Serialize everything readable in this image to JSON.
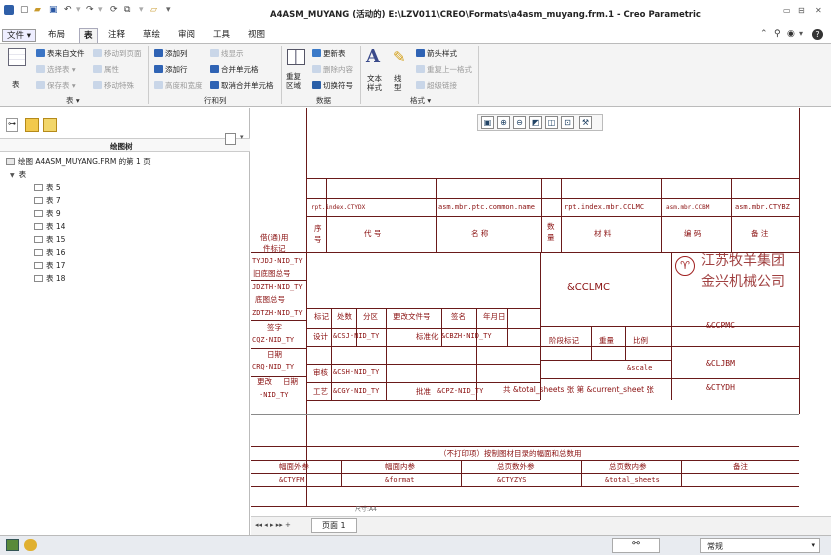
{
  "window": {
    "title": "A4ASM_MUYANG (活动的) E:\\LZV011\\CREO\\Formats\\a4asm_muyang.frm.1 - Creo Parametric",
    "minimize": "▭",
    "restore": "⊟",
    "close": "✕"
  },
  "menu": {
    "file": "文件 ▾",
    "tabs": [
      "布局",
      "表",
      "注释",
      "草绘",
      "审阅",
      "工具",
      "视图"
    ]
  },
  "ribbon": {
    "table_group": {
      "big": "表",
      "items": [
        "表来自文件",
        "移动到页面",
        "选择表 ▾",
        "属性",
        "保存表 ▾",
        "移动特殊"
      ],
      "label": "表 ▾"
    },
    "rowcol_group": {
      "items": [
        "添加列",
        "线显示",
        "添加行",
        "合并单元格",
        "高度和宽度",
        "取消合并单元格"
      ],
      "label": "行和列"
    },
    "data_group": {
      "big": "重复区域",
      "items": [
        "更新表",
        "删除内容",
        "切换符号"
      ],
      "label": "数据"
    },
    "format_group": {
      "text_style": "文本样式",
      "line_style": "线型",
      "items": [
        "箭头样式",
        "重复上一格式",
        "超级链接"
      ],
      "label": "格式 ▾"
    }
  },
  "drawing_tree": {
    "title": "绘图树",
    "root": "绘图 A4ASM_MUYANG.FRM 的第 1 页",
    "table_node": "表",
    "tables": [
      "表 5",
      "表 7",
      "表 9",
      "表 14",
      "表 15",
      "表 16",
      "表 17",
      "表 18"
    ]
  },
  "drawing": {
    "header_row": {
      "c1": "rpt.index.CTYDX",
      "c2": "asm.mbr.ptc.common.name",
      "c3": "rpt.index.mbr.CCLMC",
      "c4": "asm.mbr.CCBM",
      "c5": "asm.mbr.CTYBZ"
    },
    "col_headers": [
      "序号",
      "代  号",
      "名  称",
      "数量",
      "材  料",
      "编  码",
      "备  注"
    ],
    "left_labels": [
      "借(通)用",
      "件标记",
      "旧底图总号",
      "底图总号",
      "签字",
      "日期",
      "更改",
      "日期"
    ],
    "tb_values": [
      "TYJDJ·NID_TY",
      "JDZTH·NID_TY",
      "ZDTZH·NID_TY",
      "CQZ·NID_TY",
      "CRQ·NID_TY",
      "·NID_TY"
    ],
    "cclmc": "&CCLMC",
    "company1": "江苏牧羊集团",
    "company2": "金兴机械公司",
    "revision_headers": [
      "标记",
      "处数",
      "分区",
      "更改文件号",
      "签名",
      "年月日"
    ],
    "approvals": [
      "设计",
      "&CSJ·NID_TY",
      "标准化",
      "&CBZH·NID_TY",
      "审核",
      "&CSH·NID_TY",
      "工艺",
      "&CGY·NID_TY",
      "批准",
      "&CPZ·NID_TY"
    ],
    "stage_headers": [
      "阶段标记",
      "重量",
      "比例"
    ],
    "scale": "&scale",
    "sheets": "共 &total_sheets 张  第 &current_sheet 张",
    "ccpmc": "&CCPMC",
    "cljbm": "&CLJBM",
    "ctydh": "&CTYDH",
    "bottom_title": "（不打印项）按制图材目录的幅面和总数用",
    "bottom_headers": [
      "幅面外参",
      "幅面内参",
      "总页数外参",
      "总页数内参",
      "备注"
    ],
    "bottom_values": [
      "&CTYFM",
      "&format",
      "&CTYZYS",
      "&total_sheets",
      ""
    ],
    "sheet_size": "尺寸:A4"
  },
  "page_tabs": {
    "nav": "◂◂  ◂  ▸  ▸▸  +",
    "page1": "页面 1"
  },
  "status": {
    "filter": "常规",
    "find_icon": "binoculars-icon"
  }
}
